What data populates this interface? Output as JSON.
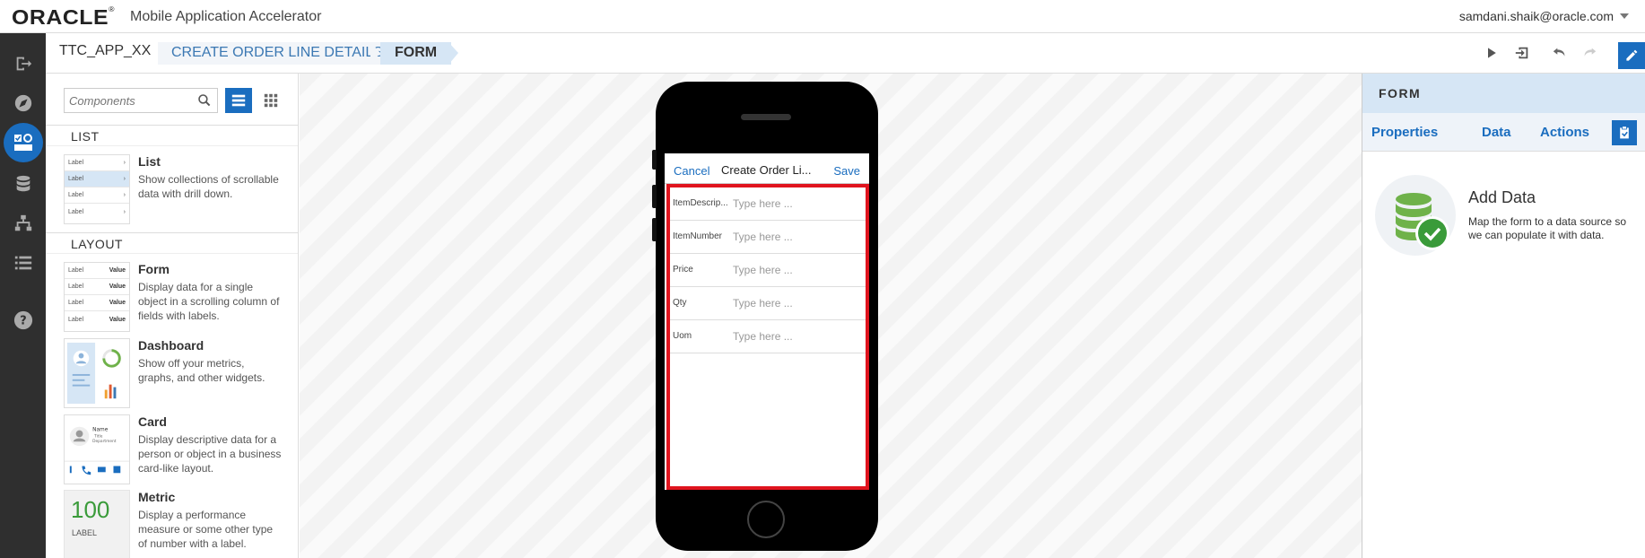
{
  "header": {
    "logo": "ORACLE",
    "logo_mark": "®",
    "app_name": "Mobile Application Accelerator",
    "user": "samdani.shaik@oracle.com"
  },
  "breadcrumb": {
    "app": "TTC_APP_XX",
    "page": "CREATE ORDER LINE DETAILS",
    "current": "FORM"
  },
  "left_nav": {
    "items": [
      "exit-icon",
      "explore-icon",
      "components-icon",
      "database-icon",
      "structure-icon",
      "list-icon",
      "help-icon"
    ],
    "active": "components-icon"
  },
  "components": {
    "search_placeholder": "Components",
    "sections": {
      "list": "LIST",
      "layout": "LAYOUT"
    },
    "items": [
      {
        "title": "List",
        "desc": "Show collections of scrollable data with drill down."
      },
      {
        "title": "Form",
        "desc": "Display data for a single object in a scrolling column of fields with labels."
      },
      {
        "title": "Dashboard",
        "desc": "Show off your metrics, graphs, and other widgets."
      },
      {
        "title": "Card",
        "desc": "Display descriptive data for a person or object in a business card-like layout."
      },
      {
        "title": "Metric",
        "desc": "Display a performance measure or some other type of number with a label."
      }
    ],
    "thumb_list": {
      "label": "Label"
    },
    "thumb_form": {
      "label": "Label",
      "value": "Value"
    },
    "thumb_card": {
      "name": "Name",
      "title": "Title",
      "dept": "Department"
    },
    "thumb_metric": {
      "value": "100",
      "label": "LABEL"
    }
  },
  "phone": {
    "cancel": "Cancel",
    "title": "Create Order Li...",
    "save": "Save",
    "fields": [
      {
        "label": "ItemDescrip...",
        "placeholder": "Type here ..."
      },
      {
        "label": "ItemNumber",
        "placeholder": "Type here ..."
      },
      {
        "label": "Price",
        "placeholder": "Type here ..."
      },
      {
        "label": "Qty",
        "placeholder": "Type here ..."
      },
      {
        "label": "Uom",
        "placeholder": "Type here ..."
      }
    ]
  },
  "right_panel": {
    "title": "FORM",
    "tabs": [
      "Properties",
      "Data",
      "Actions"
    ],
    "add_data_title": "Add Data",
    "add_data_desc": "Map the form to a data source so we can populate it with data."
  },
  "colors": {
    "accent": "#1a6dbf",
    "highlight": "#e0141e",
    "success": "#3a9b3a",
    "data_icon": "#6fb24a"
  }
}
